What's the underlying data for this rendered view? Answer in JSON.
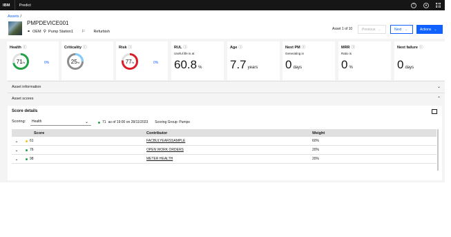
{
  "topbar": {
    "brand": "IBM",
    "product": "Predict",
    "help_icon": "help-icon",
    "user_icon": "user-avatar-icon",
    "apps_icon": "app-switcher-icon"
  },
  "header": {
    "breadcrumb": "Assets",
    "breadcrumb_sep": "/",
    "asset_id": "PMPDEVICE001",
    "oem": "OEM",
    "location": "Pump Station1",
    "status": "Refurbish",
    "asset_count": "Asset 1 of 10",
    "previous_label": "Previous",
    "next_label": "Next",
    "actions_label": "Actions"
  },
  "kpis": {
    "health": {
      "title": "Health",
      "value": "71",
      "unit": "%",
      "pct": "0%",
      "level": 0.71,
      "color": "#24a148"
    },
    "criticality": {
      "title": "Criticality",
      "value": "25",
      "unit": "%",
      "level": 0.25,
      "color": "#82cfff"
    },
    "risk": {
      "title": "Risk",
      "value": "77",
      "unit": "%",
      "pct": "0%",
      "level": 0.77,
      "color": "#da1e28"
    },
    "rul": {
      "title": "RUL",
      "sub": "Useful life is at",
      "value": "60.8",
      "unit": "%"
    },
    "age": {
      "title": "Age",
      "value": "7.7",
      "unit": "years"
    },
    "next_pm": {
      "title": "Next PM",
      "sub": "Generating in",
      "value": "0",
      "unit": "days"
    },
    "mrr": {
      "title": "MRR",
      "sub": "Ratio is",
      "value": "0",
      "unit": "%"
    },
    "next_failure": {
      "title": "Next failure",
      "value": "0",
      "unit": "days"
    }
  },
  "accordions": {
    "asset_info": "Asset information",
    "asset_scores": "Asset scores"
  },
  "score_details": {
    "title": "Score details",
    "scoring_label": "Scoring:",
    "scoring_value": "Health",
    "score": "71",
    "as_of": "as of 19:00 on 28/11/2023",
    "scoring_group": "Scoring Group:  Pumps",
    "columns": {
      "score": "Score",
      "contributor": "Contributor",
      "weight": "Weight"
    },
    "rows": [
      {
        "score": "61",
        "contributor": "FACBULYEARSSAMPLE",
        "weight": "60%",
        "color": "#f1c21b"
      },
      {
        "score": "76",
        "contributor": "OPEN WORK ORDERS",
        "weight": "20%",
        "color": "#24a148"
      },
      {
        "score": "98",
        "contributor": "METER HEALTH",
        "weight": "20%",
        "color": "#24a148"
      }
    ]
  },
  "colors": {
    "accent": "#0f62fe",
    "good": "#24a148",
    "warn": "#f1c21b",
    "bad": "#da1e28"
  }
}
